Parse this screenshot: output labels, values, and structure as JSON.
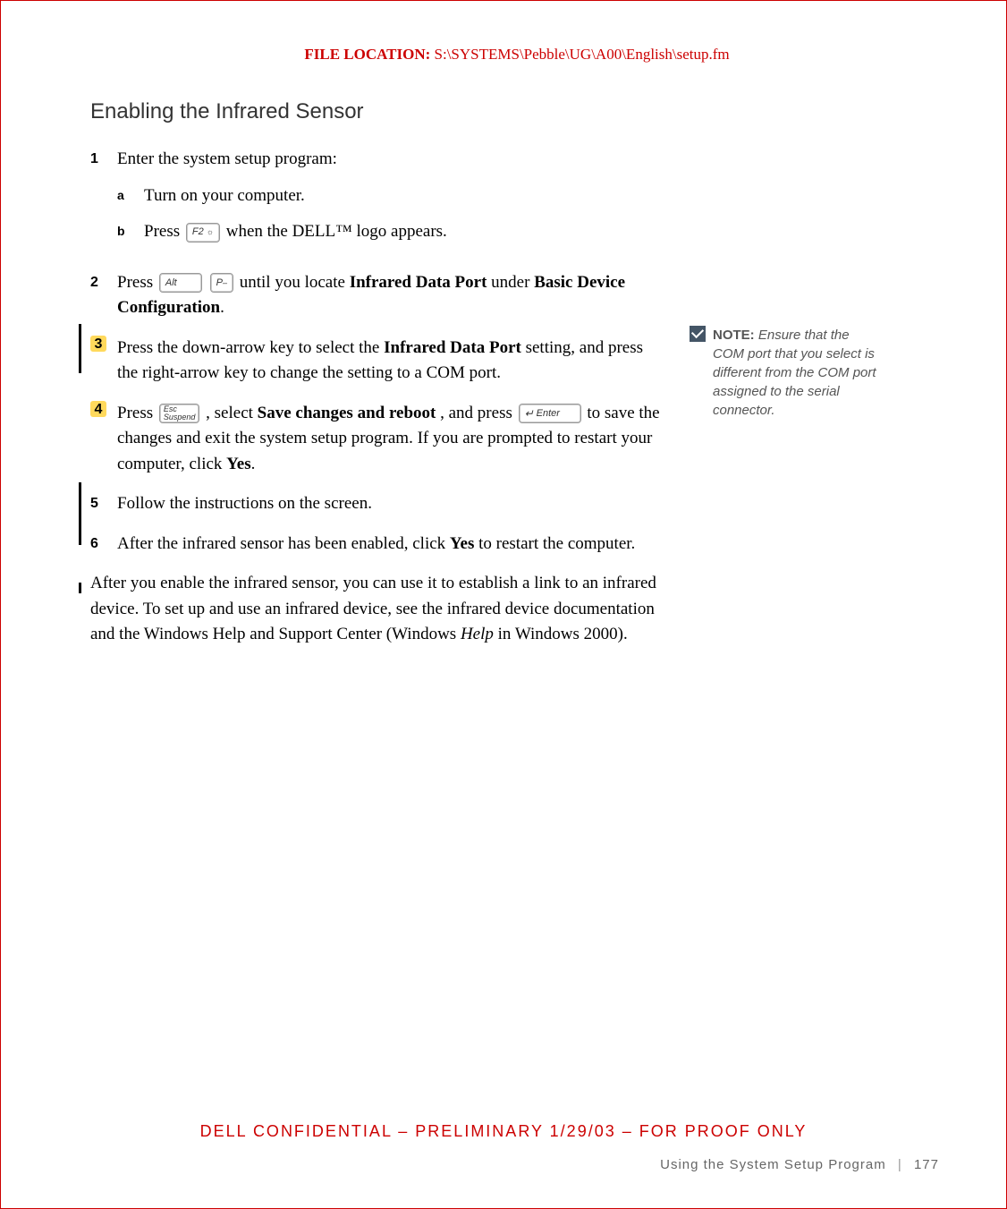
{
  "header": {
    "label": "FILE LOCATION:",
    "path": "  S:\\SYSTEMS\\Pebble\\UG\\A00\\English\\setup.fm"
  },
  "section_title": "Enabling the Infrared Sensor",
  "steps": {
    "s1": {
      "num": "1",
      "text": "Enter the system setup program:",
      "sub": {
        "a_letter": "a",
        "a_text": "Turn on your computer.",
        "b_letter": "b",
        "b_pre": "Press ",
        "b_key": "F2",
        "b_post": " when the DELL™ logo appears."
      }
    },
    "s2": {
      "num": "2",
      "pre": "Press ",
      "key1": "Alt",
      "key2": "P",
      "key2_sub": "–",
      "mid": " until you locate ",
      "bold1": "Infrared Data Port",
      "mid2": " under ",
      "bold2": "Basic Device Configuration",
      "end": "."
    },
    "s3": {
      "num": "3",
      "pre": "Press the down-arrow key to select the ",
      "bold": "Infrared Data Port",
      "post": " setting, and press the right-arrow key to change the setting to a COM port."
    },
    "s4": {
      "num": "4",
      "pre": "Press ",
      "key1_top": "Esc",
      "key1_bot": "Suspend",
      "mid1": ", select ",
      "bold": "Save changes and reboot",
      "mid2": ", and press ",
      "key2": "Enter",
      "post": " to save the changes and exit the system setup program. If you are prompted to restart your computer, click ",
      "bold2": "Yes",
      "end": "."
    },
    "s5": {
      "num": "5",
      "text": "Follow the instructions on the screen."
    },
    "s6": {
      "num": "6",
      "pre": "After the infrared sensor has been enabled, click ",
      "bold": "Yes",
      "post": " to restart the computer."
    }
  },
  "para": {
    "p1": "After you enable the infrared sensor, you can use it to establish a link to an infrared device. To set up and use an infrared device, see the infrared device documentation and the Windows Help and Support Center (Windows ",
    "italic": "Help",
    "p2": " in Windows 2000)."
  },
  "note": {
    "label": "NOTE: ",
    "text": "Ensure that the COM port that you select is different from the COM port assigned to the serial connector."
  },
  "footer": {
    "conf": "DELL CONFIDENTIAL – PRELIMINARY 1/29/03 – FOR PROOF ONLY",
    "page_title": "Using the System Setup Program",
    "page_num": "177"
  }
}
